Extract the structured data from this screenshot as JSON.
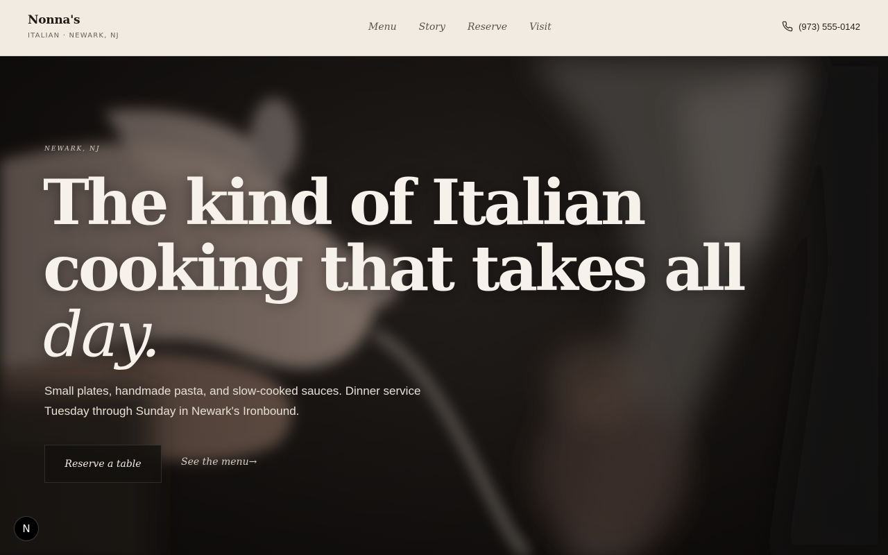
{
  "brand": {
    "name": "Nonna's",
    "tagline": "ITALIAN · NEWARK, NJ"
  },
  "nav": {
    "items": [
      {
        "label": "Menu"
      },
      {
        "label": "Story"
      },
      {
        "label": "Reserve"
      },
      {
        "label": "Visit"
      }
    ]
  },
  "contact": {
    "icon": "phone-icon",
    "phone": "(973) 555-0142"
  },
  "hero": {
    "eyebrow": "NEWARK, NJ",
    "headline_line1": "The kind of Italian",
    "headline_line2": "cooking that takes all",
    "headline_line3": "day.",
    "lede": "Small plates, handmade pasta, and slow-cooked sauces. Dinner service Tuesday through Sunday in Newark's Ironbound.",
    "primary_cta": "Reserve a table",
    "secondary_cta": "See the menu→"
  },
  "devtools": {
    "label": "N"
  },
  "colors": {
    "header_bg": "#f1ebe1",
    "hero_overlay": "#141211",
    "headline_text": "#f6f1ea",
    "body_text": "#e6dfd5"
  }
}
